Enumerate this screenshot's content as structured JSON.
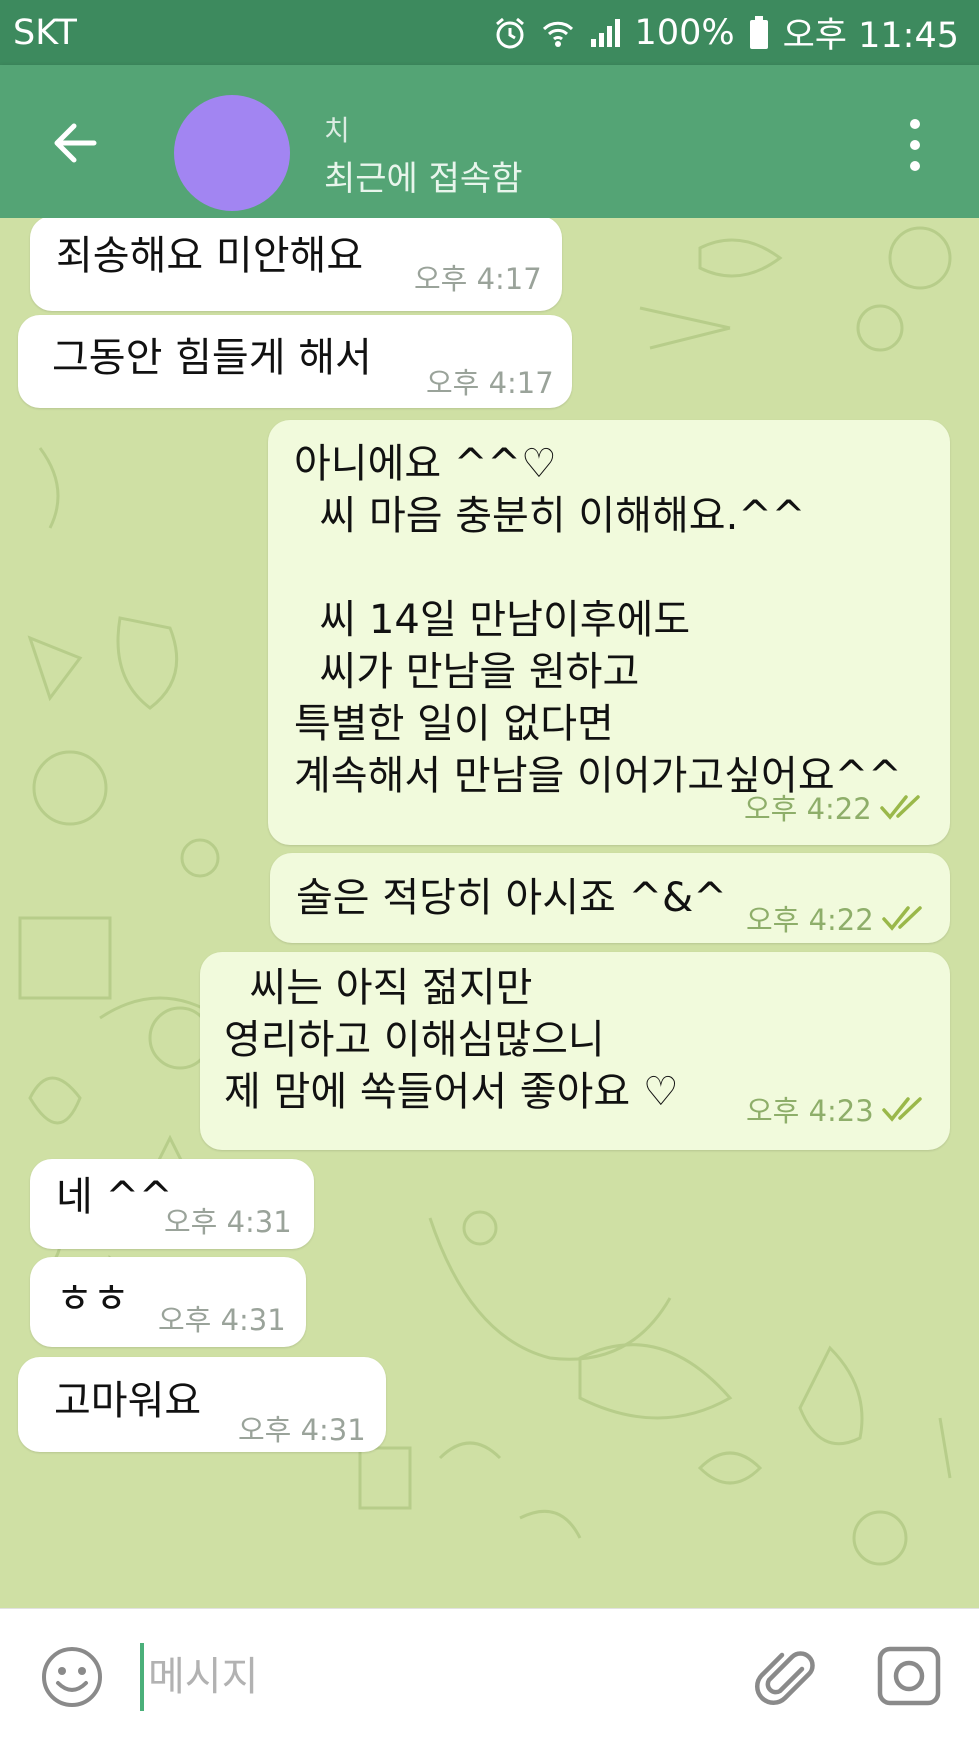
{
  "status_bar": {
    "carrier": "SKT",
    "battery": "100%",
    "time": "오후 11:45",
    "icons": [
      "alarm-icon",
      "wifi-icon",
      "signal-icon",
      "battery-icon"
    ]
  },
  "header": {
    "back_icon": "arrow-left-icon",
    "avatar_color": "#a285f2",
    "title": "치",
    "status": "최근에 접속함",
    "menu_icon": "more-vertical-icon"
  },
  "messages": [
    {
      "direction": "in",
      "lines": [
        "죄송해요 미안해요"
      ],
      "time": "오후 4:17"
    },
    {
      "direction": "in",
      "lines": [
        "그동안 힘들게 해서"
      ],
      "time": "오후 4:17"
    },
    {
      "direction": "out",
      "lines": [
        "아니에요 ^^♡",
        "  씨 마음 충분히 이해해요.^^",
        "",
        "  씨 14일 만남이후에도",
        "  씨가 만남을 원하고",
        "특별한 일이 없다면",
        "계속해서 만남을 이어가고싶어요^^"
      ],
      "time": "오후 4:22",
      "read": true
    },
    {
      "direction": "out",
      "lines": [
        "술은 적당히 아시죠 ^&^"
      ],
      "time": "오후 4:22",
      "read": true
    },
    {
      "direction": "out",
      "lines": [
        "  씨는 아직 젊지만",
        "영리하고 이해심많으니",
        "제 맘에 쏙들어서 좋아요 ♡"
      ],
      "time": "오후 4:23",
      "read": true
    },
    {
      "direction": "in",
      "lines": [
        "네 ^^"
      ],
      "time": "오후 4:31"
    },
    {
      "direction": "in",
      "lines": [
        "ㅎㅎ"
      ],
      "time": "오후 4:31"
    },
    {
      "direction": "in",
      "lines": [
        "고마워요"
      ],
      "time": "오후 4:31"
    }
  ],
  "input_bar": {
    "placeholder": "메시지",
    "emoji_icon": "smiley-icon",
    "attach_icon": "paperclip-icon",
    "camera_icon": "camera-icon"
  },
  "colors": {
    "status_bar": "#3d8a5e",
    "header": "#54a475",
    "chat_background": "#cfe0a4",
    "incoming_bubble": "#ffffff",
    "outgoing_bubble": "#f1fadc",
    "read_ticks": "#9ab84a"
  }
}
